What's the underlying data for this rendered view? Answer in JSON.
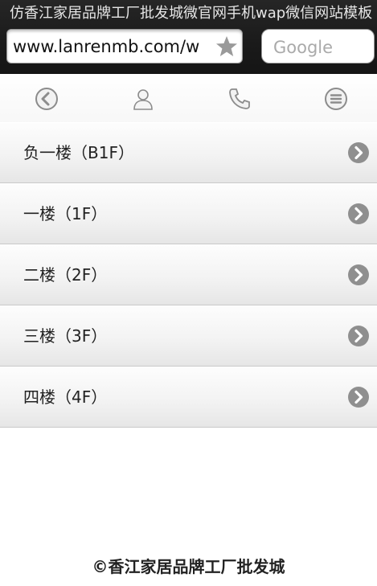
{
  "browser": {
    "page_title": "仿香江家居品牌工厂批发城微官网手机wap微信网站模板",
    "url": "www.lanrenmb.com/w",
    "search_placeholder": "Google"
  },
  "toolbar": {
    "items": [
      {
        "name": "back",
        "icon": "back-arrow-icon"
      },
      {
        "name": "user",
        "icon": "user-icon"
      },
      {
        "name": "phone",
        "icon": "phone-icon"
      },
      {
        "name": "menu",
        "icon": "menu-lines-icon"
      }
    ]
  },
  "menu": {
    "items": [
      {
        "label": "负一楼（B1F）"
      },
      {
        "label": "一楼（1F）"
      },
      {
        "label": "二楼（2F）"
      },
      {
        "label": "三楼（3F）"
      },
      {
        "label": "四楼（4F）"
      }
    ]
  },
  "footer": {
    "text": "©香江家居品牌工厂批发城"
  }
}
